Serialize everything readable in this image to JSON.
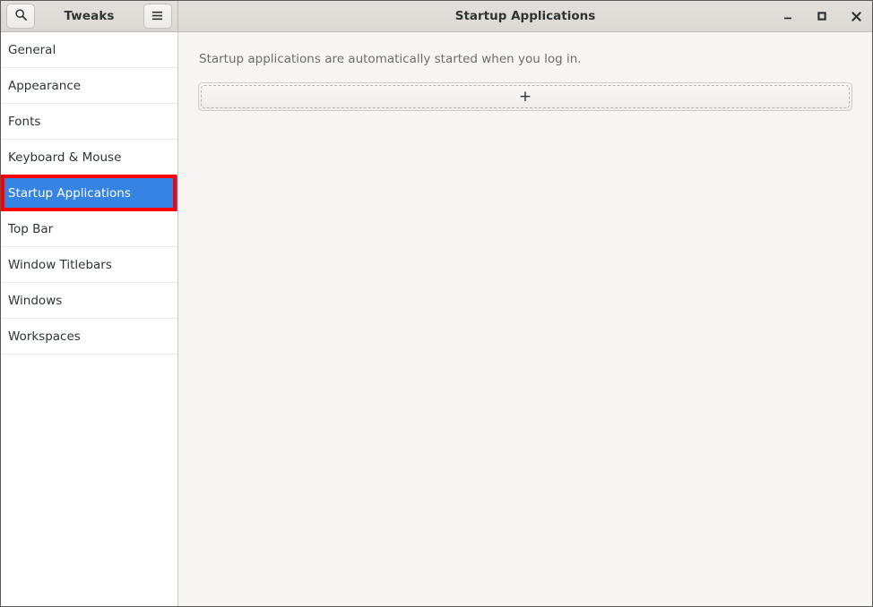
{
  "app": {
    "name": "Tweaks",
    "window_title": "Startup Applications"
  },
  "header": {
    "search_icon": "search-icon",
    "menu_icon": "hamburger-menu-icon",
    "title": "Tweaks",
    "window_title": "Startup Applications",
    "controls": {
      "minimize": "minimize-icon",
      "maximize": "maximize-icon",
      "close": "close-icon"
    }
  },
  "sidebar": {
    "selected": "Startup Applications",
    "selected_color": "#3584e4",
    "highlight_color": "#ff0000",
    "items": [
      {
        "label": "General"
      },
      {
        "label": "Appearance"
      },
      {
        "label": "Fonts"
      },
      {
        "label": "Keyboard & Mouse"
      },
      {
        "label": "Startup Applications"
      },
      {
        "label": "Top Bar"
      },
      {
        "label": "Window Titlebars"
      },
      {
        "label": "Windows"
      },
      {
        "label": "Workspaces"
      }
    ]
  },
  "main": {
    "description": "Startup applications are automatically started when you log in.",
    "add_button": {
      "label": "+",
      "icon": "plus-icon"
    }
  }
}
